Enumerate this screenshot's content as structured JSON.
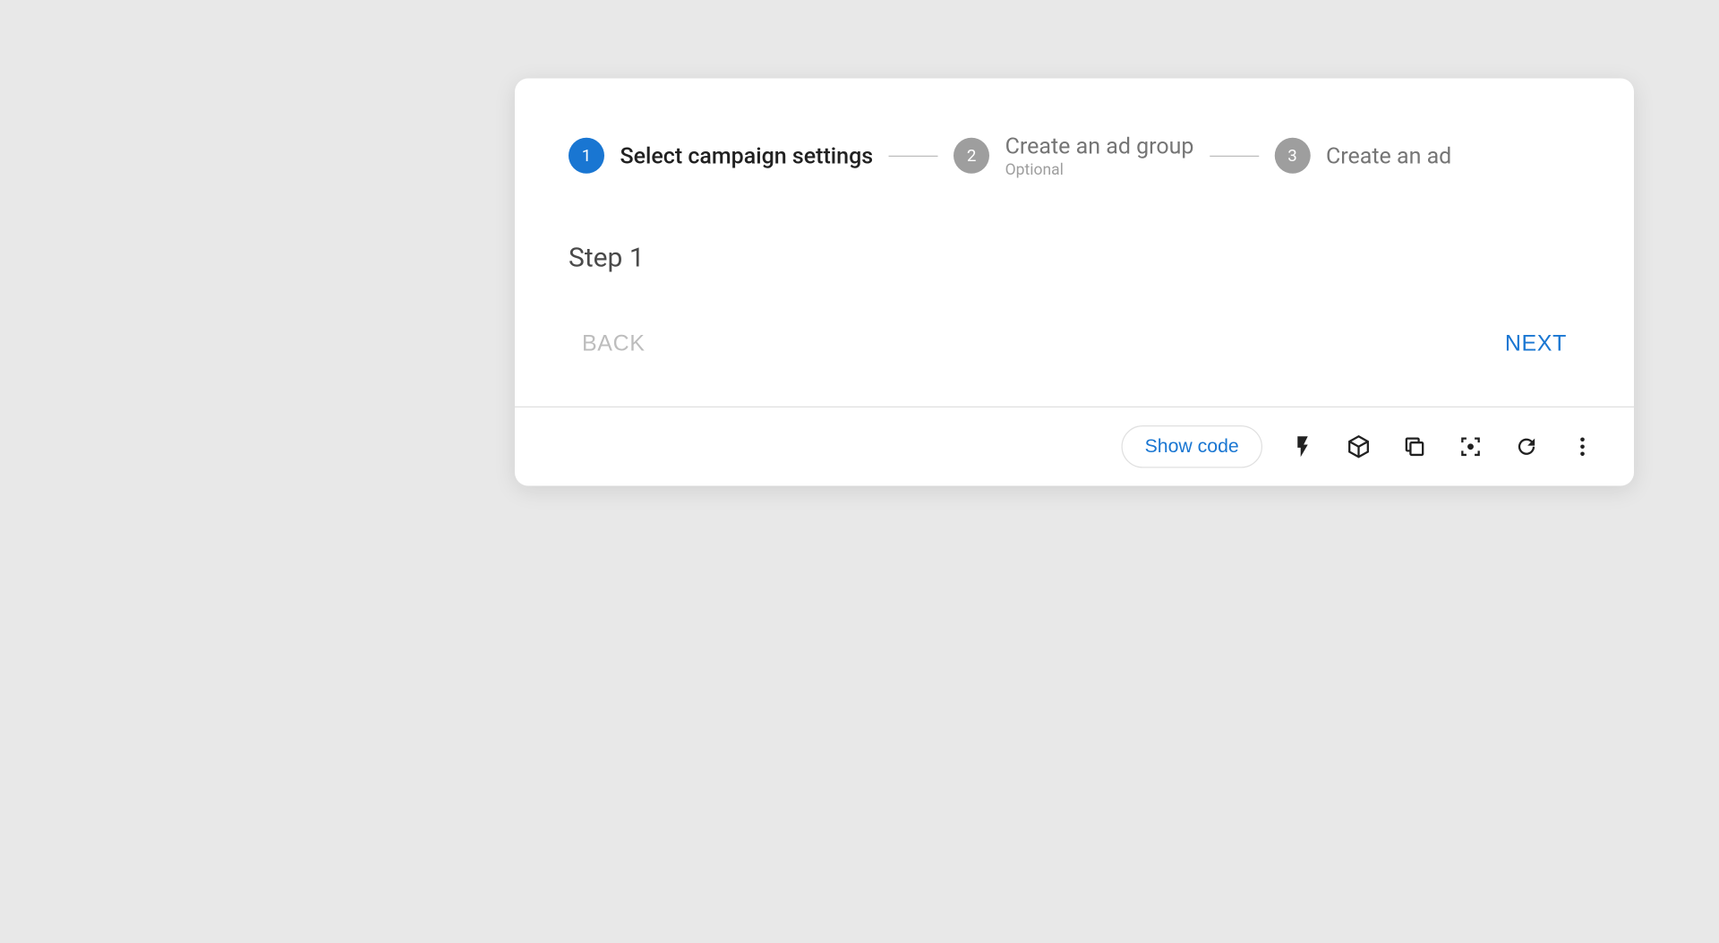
{
  "stepper": {
    "steps": [
      {
        "num": "1",
        "label": "Select campaign settings",
        "sublabel": "",
        "active": true
      },
      {
        "num": "2",
        "label": "Create an ad group",
        "sublabel": "Optional",
        "active": false
      },
      {
        "num": "3",
        "label": "Create an ad",
        "sublabel": "",
        "active": false
      }
    ]
  },
  "body": {
    "step_title": "Step 1"
  },
  "nav": {
    "back": "BACK",
    "next": "NEXT"
  },
  "footer": {
    "show_code": "Show code",
    "icons": [
      "bolt",
      "cube",
      "copy",
      "fullscreen",
      "refresh",
      "more"
    ]
  }
}
